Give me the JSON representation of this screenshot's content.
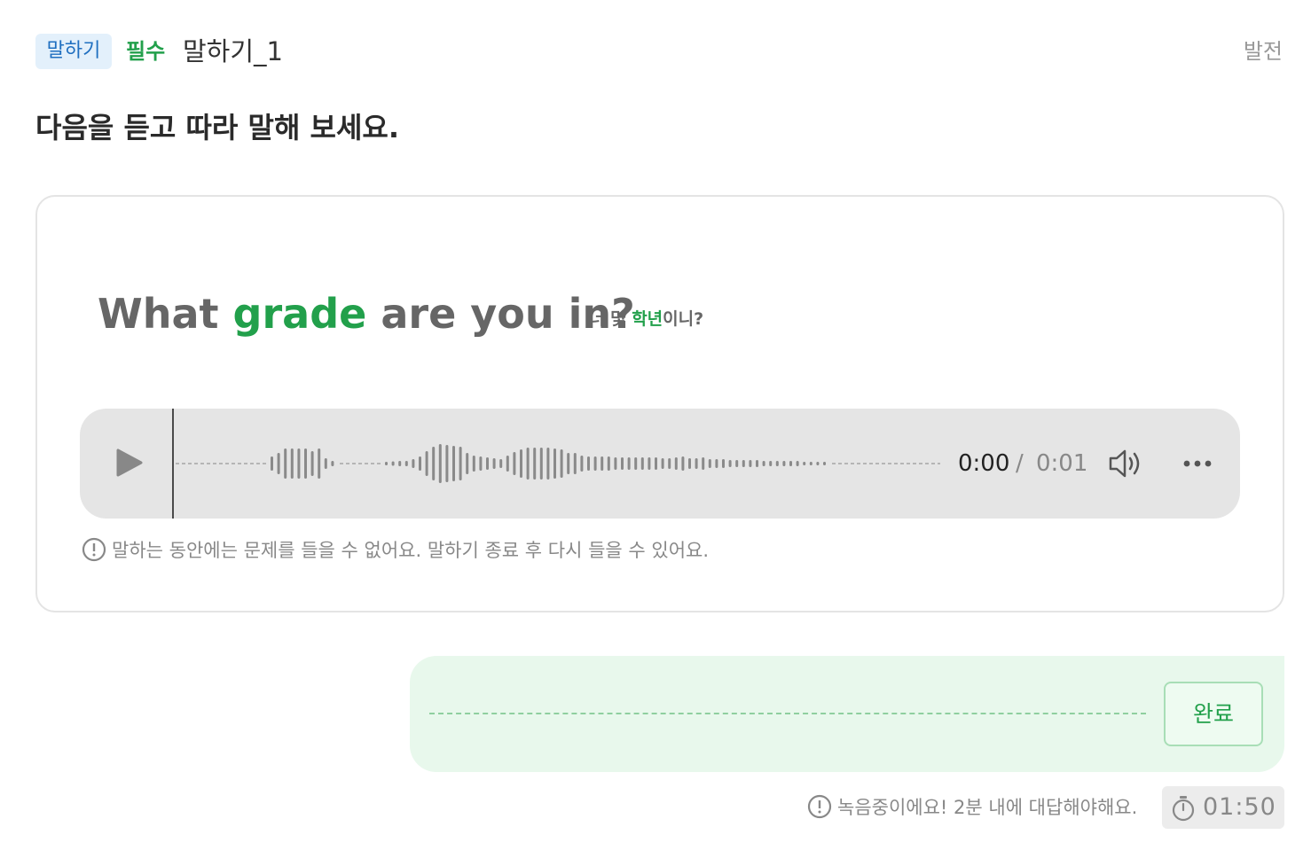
{
  "header": {
    "category_badge": "말하기",
    "required_badge": "필수",
    "question_title": "말하기_1",
    "level": "발전"
  },
  "instruction": "다음을 듣고 따라 말해 보세요.",
  "prompt": {
    "sentence_before": "What ",
    "sentence_highlight": "grade",
    "sentence_after": " are you in?",
    "translation_before": "너 몇 ",
    "translation_highlight": "학년",
    "translation_after": "이니?"
  },
  "audio_player": {
    "current_time": "0:00",
    "separator": "/",
    "total_time": "0:01",
    "progress": 0.0,
    "play_icon": "play-icon",
    "volume_icon": "volume-icon",
    "more_icon": "more-horizontal-icon"
  },
  "listen_notice": "말하는 동안에는 문제를 들을 수 없어요. 말하기 종료 후 다시 들을 수 있어요.",
  "answer": {
    "done_button": "완료"
  },
  "recording_notice": "녹음중이에요! 2분 내에 대답해야해요.",
  "timer": {
    "remaining": "01:50",
    "icon": "stopwatch-icon"
  },
  "colors": {
    "accent_green": "#22a04b",
    "badge_blue": "#1f6fc0",
    "badge_blue_bg": "#e3f0fb",
    "answer_bg": "#e8f8ec"
  }
}
